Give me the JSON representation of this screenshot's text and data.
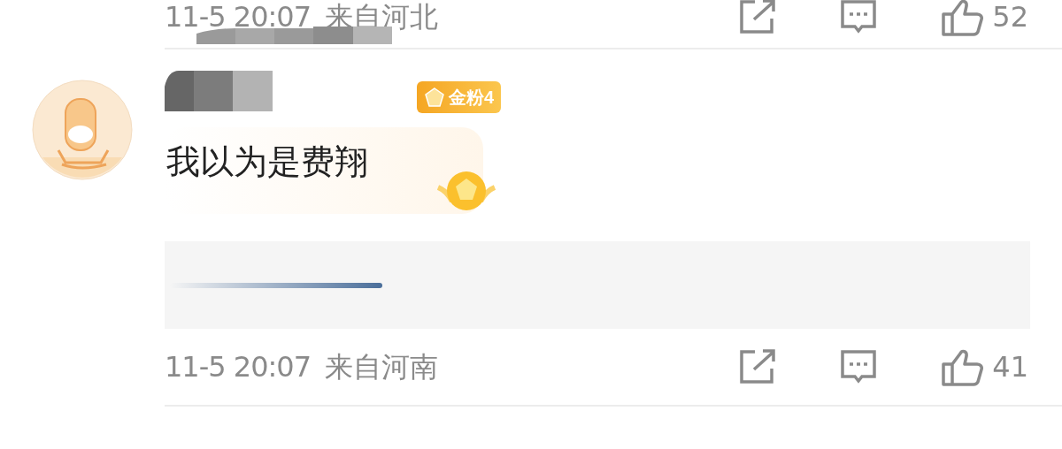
{
  "previous_comment": {
    "time": "11-5 20:07",
    "location": "来自河北",
    "likes": "52"
  },
  "comment": {
    "badge": "金粉4",
    "text": "我以为是费翔",
    "time": "11-5 20:07",
    "location": "来自河南",
    "likes": "41"
  }
}
